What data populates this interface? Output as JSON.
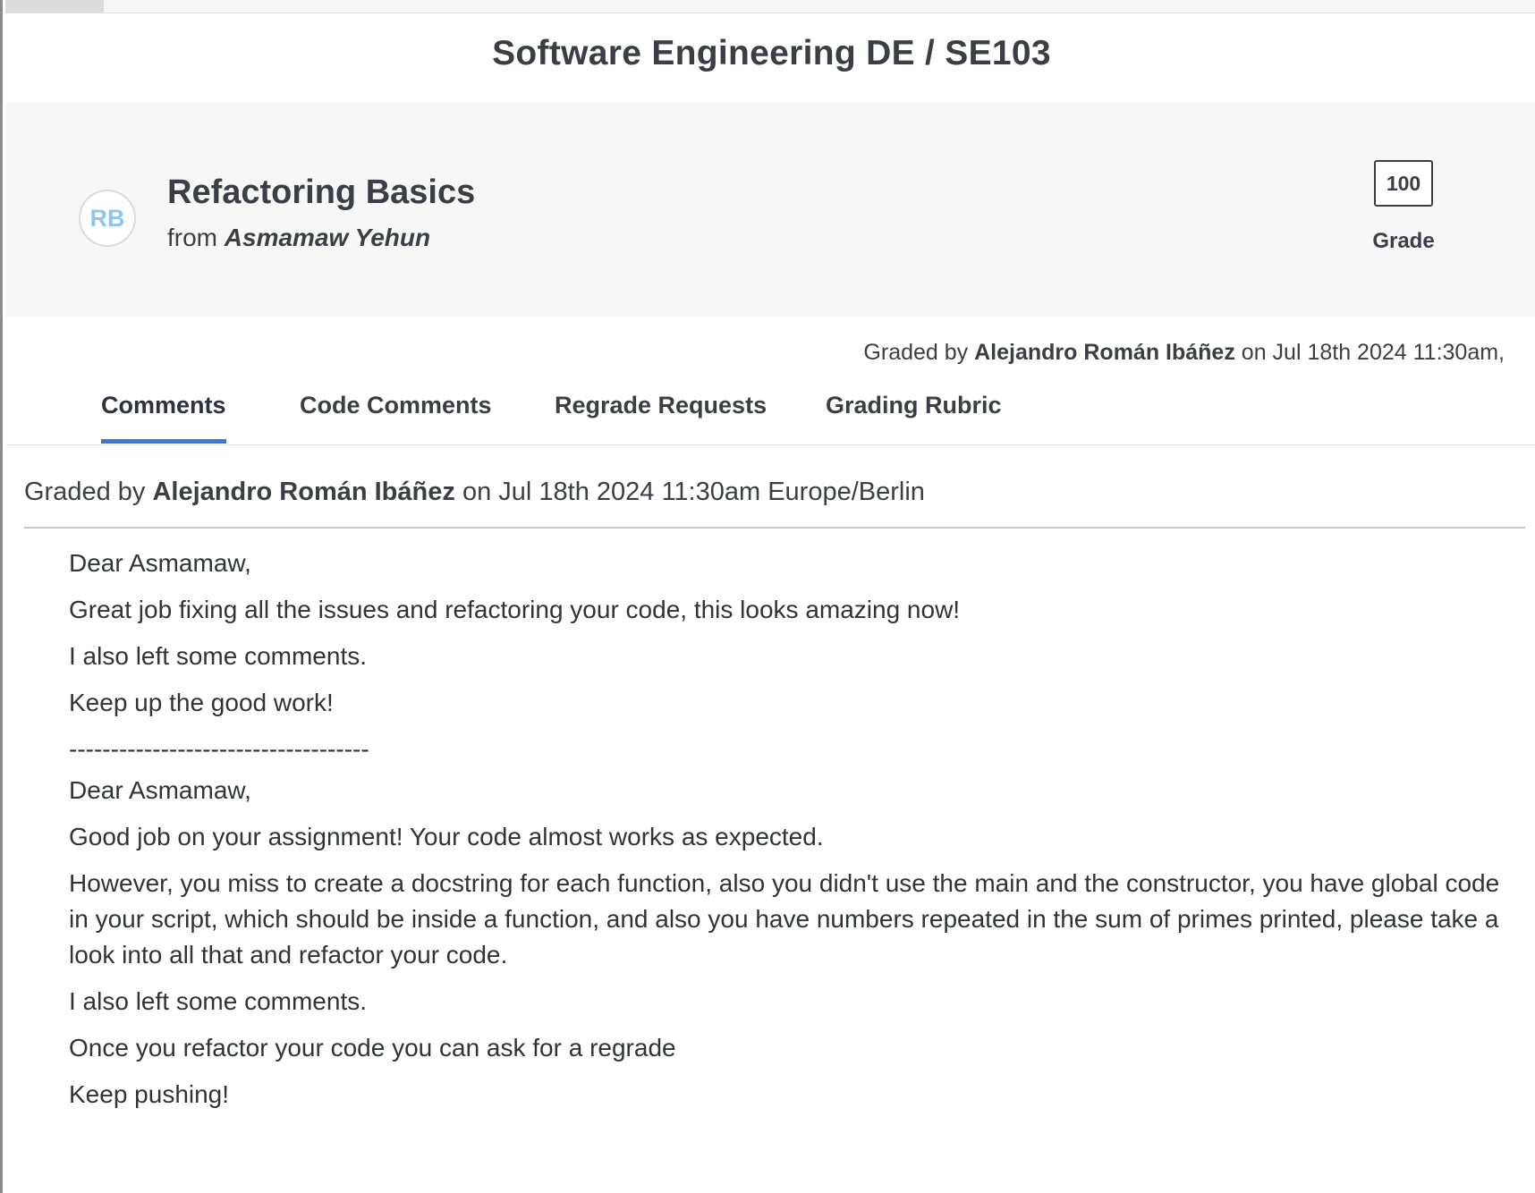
{
  "course": {
    "title": "Software Engineering DE / SE103"
  },
  "assignment": {
    "avatar_initials": "RB",
    "title": "Refactoring Basics",
    "from_label": "from",
    "author": "Asmamaw Yehun",
    "grade_value": "100",
    "grade_label": "Grade"
  },
  "graded_summary": {
    "prefix": "Graded by",
    "grader": "Alejandro Román Ibáñez",
    "suffix": "on Jul 18th 2024 11:30am,"
  },
  "tabs": [
    {
      "label": "Comments",
      "active": true
    },
    {
      "label": "Code Comments",
      "active": false
    },
    {
      "label": "Regrade Requests",
      "active": false
    },
    {
      "label": "Grading Rubric",
      "active": false
    }
  ],
  "comment": {
    "meta_prefix": "Graded by",
    "grader": "Alejandro Román Ibáñez",
    "meta_suffix": "on Jul 18th 2024 11:30am Europe/Berlin",
    "lines": [
      "Dear Asmamaw,",
      "Great job fixing all the issues and refactoring your code, this looks amazing now!",
      "I also left some comments.",
      "Keep up the good work!",
      "------------------------------------",
      "Dear Asmamaw,",
      "Good job on your assignment! Your code almost works as expected.",
      "However, you miss to create a docstring for each function, also you didn't use the main and the constructor, you have global code in your script, which should be inside a function, and also you have numbers repeated in the sum of primes printed, please take a look into all that and refactor your code.",
      "I also left some comments.",
      "Once you refactor your code you can ask for a regrade",
      "Keep pushing!"
    ]
  },
  "colors": {
    "text": "#3a3f47",
    "active_tab_underline": "#3b78d8",
    "avatar_text": "#8ec6ee",
    "header_panel_bg": "#f7f7f7"
  }
}
